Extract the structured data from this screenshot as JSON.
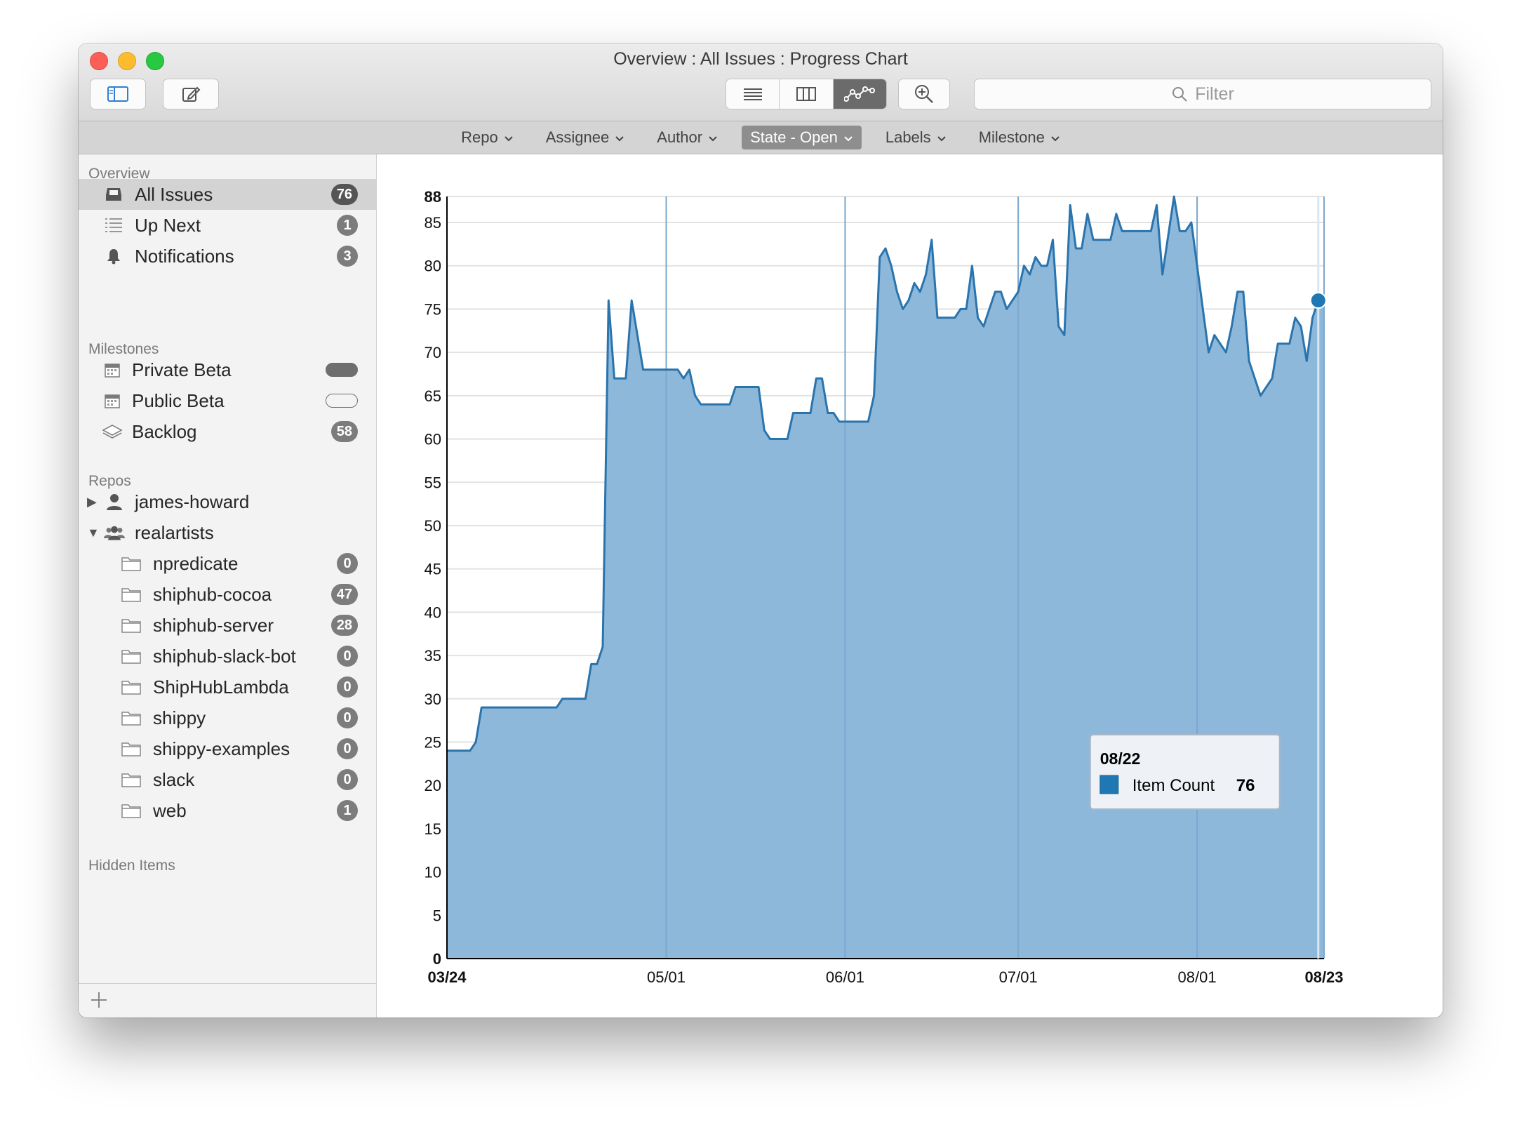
{
  "window": {
    "title": "Overview : All Issues : Progress Chart"
  },
  "toolbar": {
    "search_placeholder": "Filter"
  },
  "filters": [
    {
      "label": "Repo",
      "active": false
    },
    {
      "label": "Assignee",
      "active": false
    },
    {
      "label": "Author",
      "active": false
    },
    {
      "label": "State - Open",
      "active": true
    },
    {
      "label": "Labels",
      "active": false
    },
    {
      "label": "Milestone",
      "active": false
    }
  ],
  "sidebar": {
    "overview_label": "Overview",
    "overview": [
      {
        "label": "All Issues",
        "count": "76",
        "icon": "inbox-tray-icon",
        "selected": true
      },
      {
        "label": "Up Next",
        "count": "1",
        "icon": "list-icon"
      },
      {
        "label": "Notifications",
        "count": "3",
        "icon": "bell-icon"
      }
    ],
    "milestones_label": "Milestones",
    "milestones": [
      {
        "label": "Private Beta",
        "progress": 1.0,
        "icon": "calendar-icon"
      },
      {
        "label": "Public Beta",
        "progress": 0.0,
        "icon": "calendar-icon"
      },
      {
        "label": "Backlog",
        "count": "58",
        "icon": "layers-icon"
      }
    ],
    "repos_label": "Repos",
    "owners": [
      {
        "label": "james-howard",
        "expanded": false,
        "icon": "person-icon"
      },
      {
        "label": "realartists",
        "expanded": true,
        "icon": "group-icon"
      }
    ],
    "repos": [
      {
        "label": "npredicate",
        "count": "0"
      },
      {
        "label": "shiphub-cocoa",
        "count": "47"
      },
      {
        "label": "shiphub-server",
        "count": "28"
      },
      {
        "label": "shiphub-slack-bot",
        "count": "0"
      },
      {
        "label": "ShipHubLambda",
        "count": "0"
      },
      {
        "label": "shippy",
        "count": "0"
      },
      {
        "label": "shippy-examples",
        "count": "0"
      },
      {
        "label": "slack",
        "count": "0"
      },
      {
        "label": "web",
        "count": "1"
      }
    ],
    "hidden_label": "Hidden Items"
  },
  "tooltip": {
    "date": "08/22",
    "series": "Item Count",
    "value": "76"
  },
  "colors": {
    "fill": "#8db8da",
    "line": "#2a74ad",
    "accent": "#1f78b4"
  },
  "chart_data": {
    "type": "area",
    "ylim": [
      0,
      88
    ],
    "yticks": [
      0,
      5,
      10,
      15,
      20,
      25,
      30,
      35,
      40,
      45,
      50,
      55,
      60,
      65,
      70,
      75,
      80,
      85,
      88
    ],
    "xlim": [
      "03/24",
      "08/23"
    ],
    "xticks": [
      "03/24",
      "05/01",
      "06/01",
      "07/01",
      "08/01",
      "08/23"
    ],
    "grid": true,
    "series": [
      {
        "name": "Item Count",
        "points": [
          [
            "03/24",
            24
          ],
          [
            "03/28",
            24
          ],
          [
            "03/29",
            25
          ],
          [
            "03/30",
            29
          ],
          [
            "04/05",
            29
          ],
          [
            "04/11",
            29
          ],
          [
            "04/12",
            29
          ],
          [
            "04/13",
            30
          ],
          [
            "04/17",
            30
          ],
          [
            "04/18",
            34
          ],
          [
            "04/19",
            34
          ],
          [
            "04/20",
            36
          ],
          [
            "04/21",
            76
          ],
          [
            "04/22",
            67
          ],
          [
            "04/24",
            67
          ],
          [
            "04/25",
            76
          ],
          [
            "04/27",
            68
          ],
          [
            "05/03",
            68
          ],
          [
            "05/04",
            67
          ],
          [
            "05/05",
            68
          ],
          [
            "05/06",
            65
          ],
          [
            "05/07",
            64
          ],
          [
            "05/12",
            64
          ],
          [
            "05/13",
            66
          ],
          [
            "05/17",
            66
          ],
          [
            "05/18",
            61
          ],
          [
            "05/19",
            60
          ],
          [
            "05/22",
            60
          ],
          [
            "05/23",
            63
          ],
          [
            "05/26",
            63
          ],
          [
            "05/27",
            67
          ],
          [
            "05/28",
            67
          ],
          [
            "05/29",
            63
          ],
          [
            "05/30",
            63
          ],
          [
            "05/31",
            62
          ],
          [
            "06/05",
            62
          ],
          [
            "06/06",
            65
          ],
          [
            "06/07",
            81
          ],
          [
            "06/08",
            82
          ],
          [
            "06/09",
            80
          ],
          [
            "06/10",
            77
          ],
          [
            "06/11",
            75
          ],
          [
            "06/12",
            76
          ],
          [
            "06/13",
            78
          ],
          [
            "06/14",
            77
          ],
          [
            "06/15",
            79
          ],
          [
            "06/16",
            83
          ],
          [
            "06/17",
            74
          ],
          [
            "06/20",
            74
          ],
          [
            "06/21",
            75
          ],
          [
            "06/22",
            75
          ],
          [
            "06/23",
            80
          ],
          [
            "06/24",
            74
          ],
          [
            "06/25",
            73
          ],
          [
            "06/26",
            75
          ],
          [
            "06/27",
            77
          ],
          [
            "06/28",
            77
          ],
          [
            "06/29",
            75
          ],
          [
            "06/30",
            76
          ],
          [
            "07/01",
            77
          ],
          [
            "07/02",
            80
          ],
          [
            "07/03",
            79
          ],
          [
            "07/04",
            81
          ],
          [
            "07/05",
            80
          ],
          [
            "07/06",
            80
          ],
          [
            "07/07",
            83
          ],
          [
            "07/08",
            73
          ],
          [
            "07/09",
            72
          ],
          [
            "07/10",
            87
          ],
          [
            "07/11",
            82
          ],
          [
            "07/12",
            82
          ],
          [
            "07/13",
            86
          ],
          [
            "07/14",
            83
          ],
          [
            "07/17",
            83
          ],
          [
            "07/18",
            86
          ],
          [
            "07/19",
            84
          ],
          [
            "07/24",
            84
          ],
          [
            "07/25",
            87
          ],
          [
            "07/26",
            79
          ],
          [
            "07/28",
            88
          ],
          [
            "07/29",
            84
          ],
          [
            "07/30",
            84
          ],
          [
            "07/31",
            85
          ],
          [
            "08/01",
            80
          ],
          [
            "08/02",
            75
          ],
          [
            "08/03",
            70
          ],
          [
            "08/04",
            72
          ],
          [
            "08/06",
            70
          ],
          [
            "08/07",
            73
          ],
          [
            "08/08",
            77
          ],
          [
            "08/09",
            77
          ],
          [
            "08/10",
            69
          ],
          [
            "08/11",
            67
          ],
          [
            "08/12",
            65
          ],
          [
            "08/14",
            67
          ],
          [
            "08/15",
            71
          ],
          [
            "08/17",
            71
          ],
          [
            "08/18",
            74
          ],
          [
            "08/19",
            73
          ],
          [
            "08/20",
            69
          ],
          [
            "08/21",
            74
          ],
          [
            "08/22",
            76
          ],
          [
            "08/23",
            76
          ]
        ]
      }
    ],
    "highlight": {
      "x": "08/22",
      "y": 76
    }
  }
}
